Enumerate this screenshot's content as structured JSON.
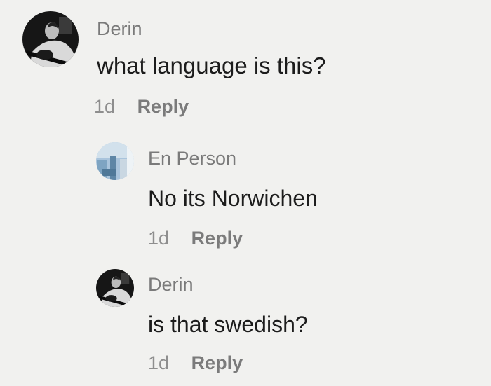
{
  "comments": [
    {
      "username": "Derin",
      "text": "what language is this?",
      "time": "1d",
      "reply_label": "Reply",
      "avatar_icon": "profile-photo-dark-guitar"
    },
    {
      "username": "En Person",
      "text": "No its Norwichen",
      "time": "1d",
      "reply_label": "Reply",
      "avatar_icon": "profile-photo-sky"
    },
    {
      "username": "Derin",
      "text": "is that swedish?",
      "time": "1d",
      "reply_label": "Reply",
      "avatar_icon": "profile-photo-dark-guitar"
    }
  ],
  "colors": {
    "background": "#f1f1ef",
    "username": "#7a7a7a",
    "text": "#1c1c1c",
    "meta": "#8e8e8e"
  }
}
